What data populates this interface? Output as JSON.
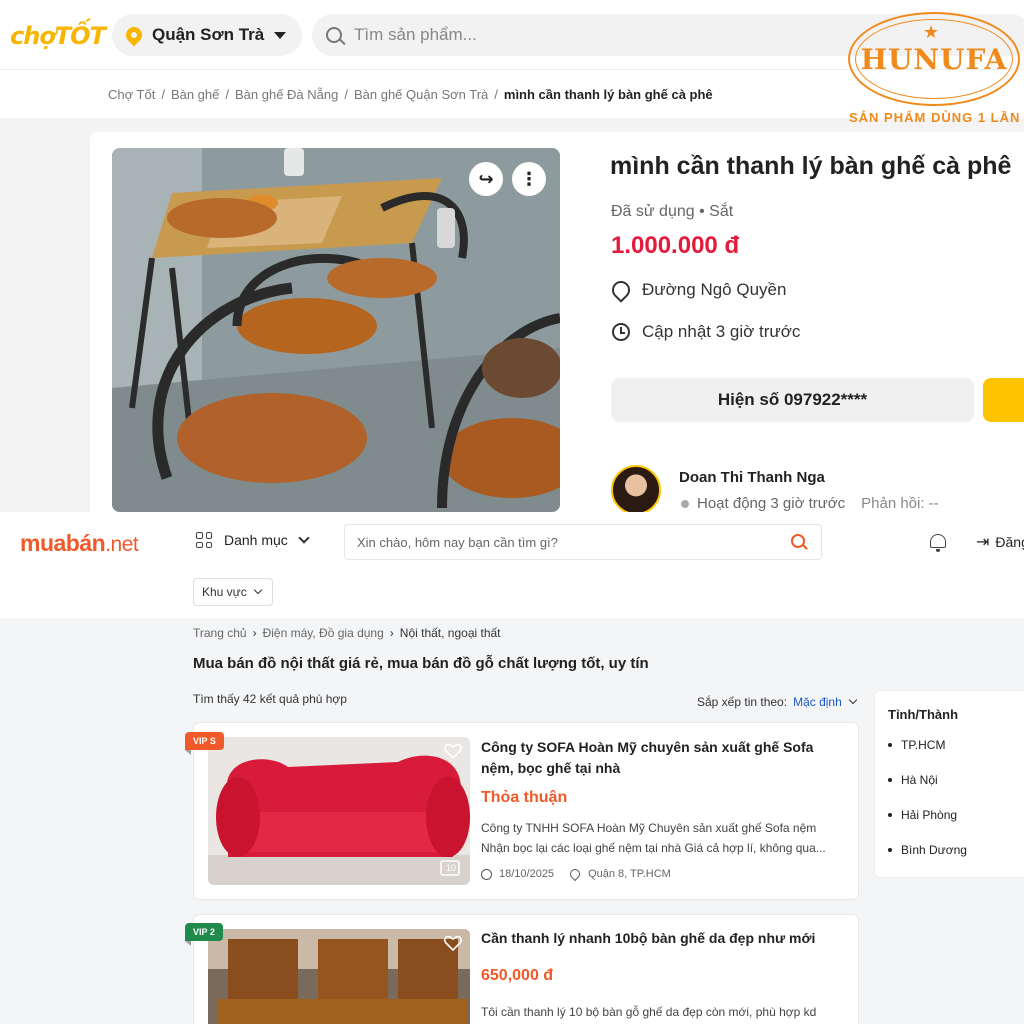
{
  "chotot": {
    "logo": "chợTỐT",
    "location": "Quận Sơn Trà",
    "search_placeholder": "Tìm sản phẩm...",
    "breadcrumb": [
      "Chợ Tốt",
      "Bàn ghế",
      "Bàn ghế Đà Nẵng",
      "Bàn ghế Quận Sơn Trà",
      "mình cần thanh lý bàn ghế cà phê"
    ],
    "listing": {
      "title": "mình cần thanh lý bàn ghế cà phê",
      "condition": "Đã sử dụng • Sắt",
      "price": "1.000.000 đ",
      "address": "Đường Ngô Quyền",
      "updated": "Cập nhật 3 giờ trước",
      "phone_button": "Hiện số 097922****",
      "share_icon": "share-icon",
      "more_icon": "more-vertical-icon"
    },
    "seller": {
      "name": "Doan Thi Thanh Nga",
      "activity": "Hoạt động 3 giờ trước",
      "reply": "Phản hồi: --"
    },
    "stamp": {
      "brand": "HUNUFA",
      "tagline": "SẢN PHẨM DÙNG 1 LẦN"
    },
    "colors": {
      "brand": "#f7b500",
      "price": "#e5193b"
    }
  },
  "muaban": {
    "logo_main": "muabán",
    "logo_suffix": ".net",
    "category_label": "Danh mục",
    "search_placeholder": "Xin chào, hôm nay bạn cần tìm gì?",
    "login_label": "Đăng",
    "area_label": "Khu vực",
    "breadcrumb": [
      "Trang chủ",
      "Điện máy, Đồ gia dụng",
      "Nội thất, ngoại thất"
    ],
    "heading": "Mua bán đồ nội thất giá rẻ, mua bán đồ gỗ chất lượng tốt, uy tín",
    "found": "Tìm thấy 42 kết quả phù hợp",
    "sort_label": "Sắp xếp tin theo:",
    "sort_value": "Mặc định",
    "items": [
      {
        "badge": "VIP S",
        "title": "Công ty SOFA Hoàn Mỹ chuyên sản xuất ghế Sofa nệm, bọc ghế tại nhà",
        "price": "Thỏa thuận",
        "desc_line1": "Công ty TNHH SOFA Hoàn Mỹ Chuyên sản xuất ghế Sofa nệm",
        "desc_line2": "Nhận bọc lại các loại ghế nệm tại nhà Giá cả hợp lí, không qua...",
        "date": "18/10/2025",
        "location": "Quận 8, TP.HCM",
        "photo_count": "10"
      },
      {
        "badge": "VIP 2",
        "title": "Cần thanh lý nhanh 10bộ bàn ghế da đẹp như mới",
        "price": "650,000 đ",
        "desc_line1": "Tôi cần thanh lý 10 bộ bàn gỗ ghế da đẹp còn mới, phù hợp kd"
      }
    ],
    "sidebar": {
      "title": "Tỉnh/Thành",
      "cities": [
        "TP.HCM",
        "Hà Nội",
        "Hải Phòng",
        "Bình Dương"
      ]
    },
    "colors": {
      "brand": "#f05a28",
      "vip_s": "#f05a28",
      "vip_2": "#1f8a4c",
      "link": "#1a56c7"
    }
  }
}
